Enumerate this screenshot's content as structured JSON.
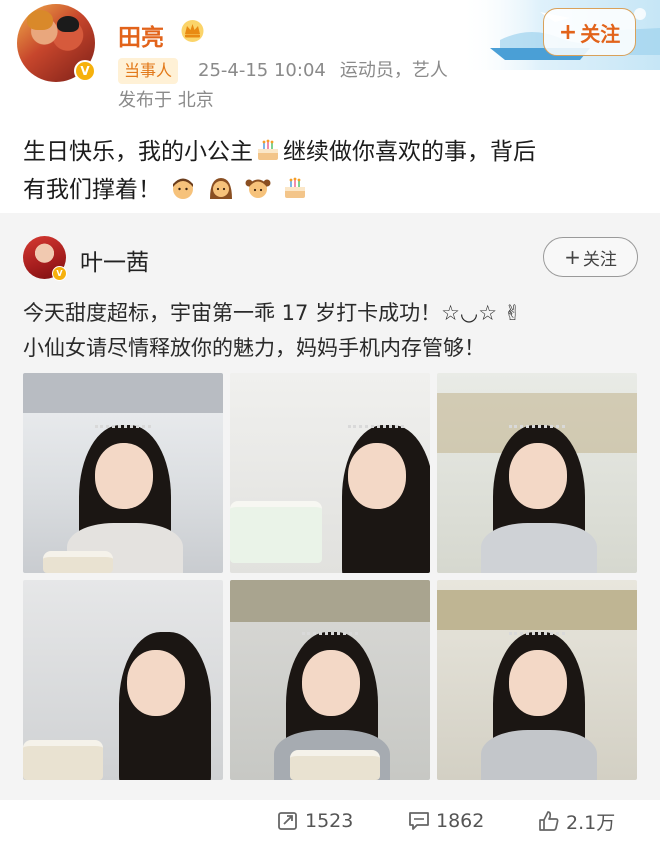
{
  "post": {
    "author": "田亮",
    "tag": "当事人",
    "time": "25-4-15 10:04",
    "role": "运动员，艺人",
    "location": "发布于 北京",
    "follow_label": "关注",
    "text_line1": "生日快乐，我的小公主",
    "text_line1_tail": "继续做你喜欢的事，背后",
    "text_line2": "有我们撑着！"
  },
  "repost": {
    "author": "叶一茜",
    "follow_label": "关注",
    "text_line1": "今天甜度超标，宇宙第一乖 17 岁打卡成功！☆◡☆ ✌",
    "text_line2": "小仙女请尽情释放你的魅力，妈妈手机内存管够！",
    "photos": [
      {
        "name": "photo-1"
      },
      {
        "name": "photo-2"
      },
      {
        "name": "photo-3"
      },
      {
        "name": "photo-4"
      },
      {
        "name": "photo-5"
      },
      {
        "name": "photo-6"
      }
    ]
  },
  "stats": {
    "reposts": "1523",
    "comments": "1862",
    "likes": "2.1万"
  },
  "colors": {
    "author_orange": "#e2631a",
    "tag_bg": "#fff1d6",
    "card_bg": "#f4f4f4",
    "verified_gold": "#f6b10d"
  },
  "icons": [
    "crown-icon",
    "verified-icon",
    "plus-icon",
    "birthday-cake-icon",
    "man-emoji-icon",
    "woman-emoji-icon",
    "girl-emoji-icon",
    "repost-icon",
    "comment-icon",
    "like-icon"
  ]
}
